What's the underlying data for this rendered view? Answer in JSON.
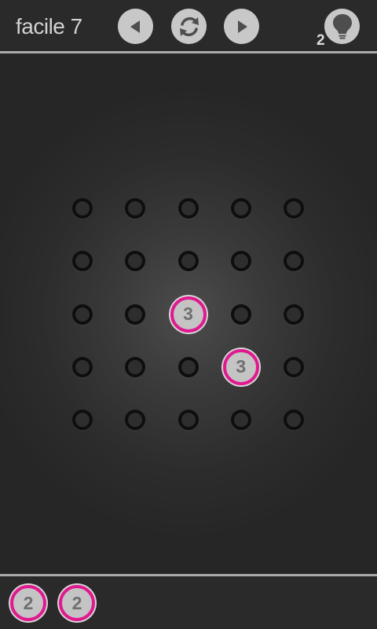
{
  "header": {
    "level_title": "facile 7",
    "hint_count": "2",
    "buttons": [
      {
        "name": "previous-level-button",
        "icon": "triangle-left-icon"
      },
      {
        "name": "restart-button",
        "icon": "refresh-icon"
      },
      {
        "name": "next-level-button",
        "icon": "triangle-right-icon"
      }
    ],
    "hint_icon": "lightbulb-icon"
  },
  "board": {
    "rows": 5,
    "cols": 5,
    "placed_tokens": [
      {
        "row": 2,
        "col": 2,
        "value": "3"
      },
      {
        "row": 3,
        "col": 3,
        "value": "3"
      }
    ]
  },
  "tray": {
    "tokens": [
      "2",
      "2"
    ]
  },
  "colors": {
    "background": "#262626",
    "token_fill": "#c4c4c4",
    "token_ring": "#e0198f",
    "token_text": "#6f6f6f",
    "hole_ring": "#0e0e0e",
    "button_fill": "#c8c8c8",
    "divider": "#aaaaaa"
  }
}
